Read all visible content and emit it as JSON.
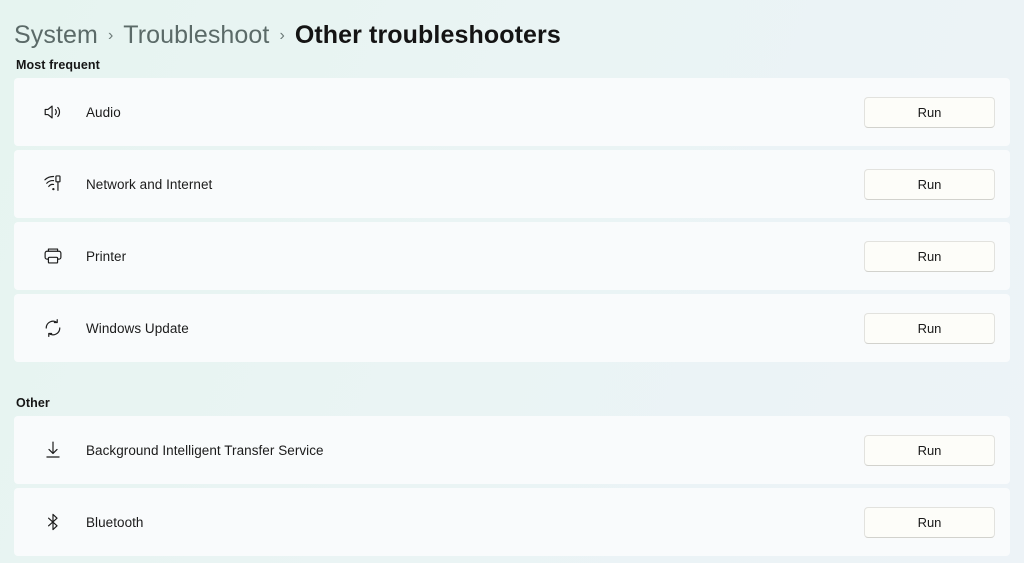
{
  "breadcrumb": {
    "separator": "›",
    "items": [
      {
        "label": "System",
        "current": false
      },
      {
        "label": "Troubleshoot",
        "current": false
      },
      {
        "label": "Other troubleshooters",
        "current": true
      }
    ]
  },
  "sections": [
    {
      "heading": "Most frequent",
      "rows": [
        {
          "icon": "speaker-icon",
          "label": "Audio",
          "action": "Run"
        },
        {
          "icon": "wifi-device-icon",
          "label": "Network and Internet",
          "action": "Run"
        },
        {
          "icon": "printer-icon",
          "label": "Printer",
          "action": "Run"
        },
        {
          "icon": "sync-arrows-icon",
          "label": "Windows Update",
          "action": "Run"
        }
      ]
    },
    {
      "heading": "Other",
      "rows": [
        {
          "icon": "download-arrow-icon",
          "label": "Background Intelligent Transfer Service",
          "action": "Run"
        },
        {
          "icon": "bluetooth-icon",
          "label": "Bluetooth",
          "action": "Run"
        }
      ]
    }
  ],
  "colors": {
    "page_background": "#e9f4f3",
    "card_background": "#f9fbfc",
    "button_background": "#fdfdf9",
    "text_primary": "#1b1b1b",
    "text_muted": "#5b6a68"
  }
}
